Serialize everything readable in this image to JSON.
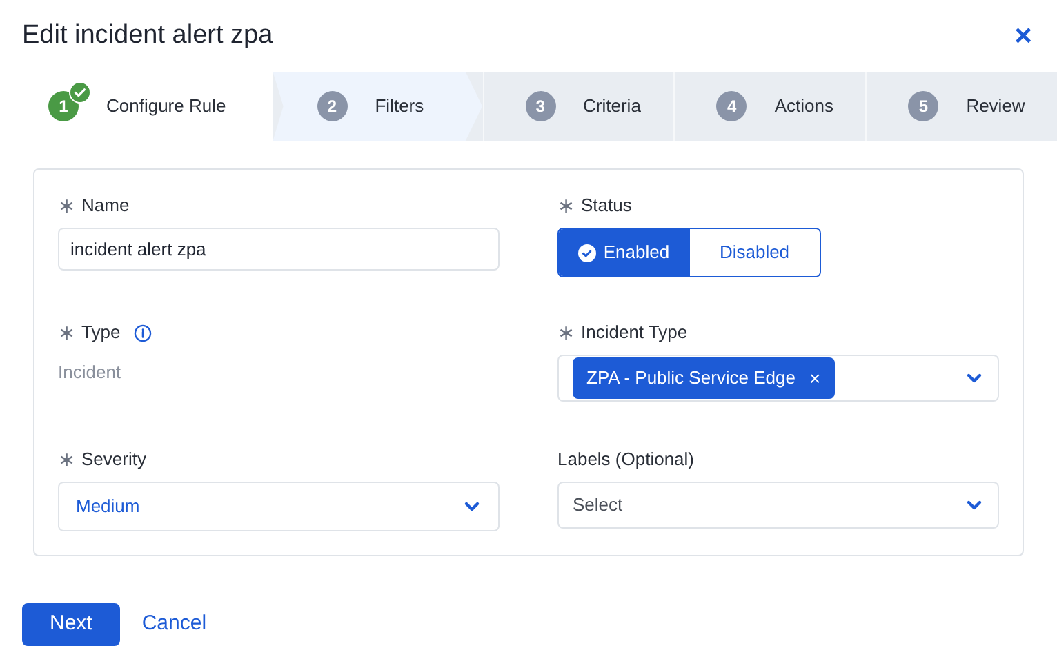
{
  "dialog": {
    "title": "Edit incident alert zpa",
    "close": "×"
  },
  "steps": [
    {
      "number": "1",
      "label": "Configure Rule",
      "completed": true,
      "selected": false
    },
    {
      "number": "2",
      "label": "Filters",
      "completed": false,
      "selected": true
    },
    {
      "number": "3",
      "label": "Criteria",
      "completed": false,
      "selected": false
    },
    {
      "number": "4",
      "label": "Actions",
      "completed": false,
      "selected": false
    },
    {
      "number": "5",
      "label": "Review",
      "completed": false,
      "selected": false
    }
  ],
  "form": {
    "name": {
      "label": "Name",
      "required_mark": "∗",
      "value": "incident alert zpa"
    },
    "status": {
      "label": "Status",
      "required_mark": "∗",
      "options": [
        {
          "label": "Enabled",
          "selected": true
        },
        {
          "label": "Disabled",
          "selected": false
        }
      ]
    },
    "type": {
      "label": "Type",
      "required_mark": "∗",
      "value": "Incident"
    },
    "incident_type": {
      "label": "Incident Type",
      "required_mark": "∗",
      "tags": [
        "ZPA - Public Service Edge"
      ],
      "tag_remove": "×"
    },
    "severity": {
      "label": "Severity",
      "required_mark": "∗",
      "value": "Medium"
    },
    "labels": {
      "label": "Labels (Optional)",
      "placeholder": "Select"
    }
  },
  "buttons": {
    "next": "Next",
    "cancel": "Cancel"
  }
}
